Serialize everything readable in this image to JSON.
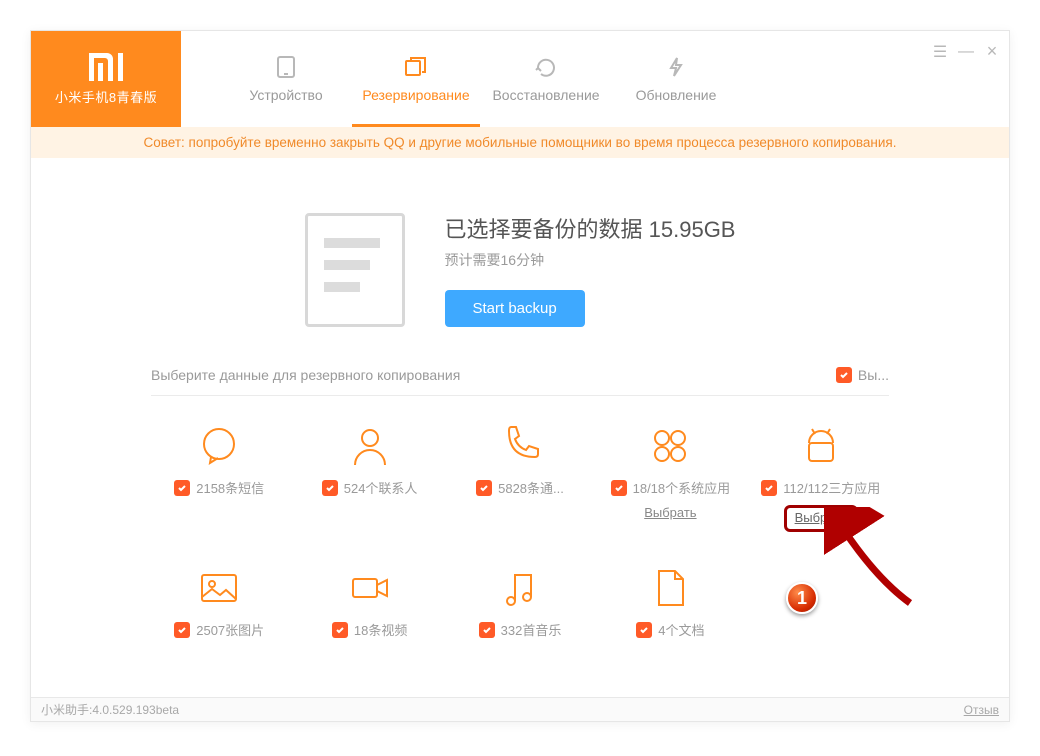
{
  "header": {
    "device_name": "小米手机8青春版",
    "nav": {
      "device": "Устройство",
      "backup": "Резервирование",
      "restore": "Восстановление",
      "update": "Обновление"
    }
  },
  "tip_banner": "Совет: попробуйте временно закрыть QQ и другие мобильные помощники во время процесса резервного копирования.",
  "summary": {
    "title_prefix": "已选择要备份的数据",
    "size": "15.95GB",
    "eta": "预计需要16分钟",
    "button": "Start backup"
  },
  "section": {
    "title": "Выберите данные для резервного копирования",
    "select_all": "Вы...",
    "choose_label": "Выбрать"
  },
  "categories": {
    "sms": {
      "label": "2158条短信"
    },
    "contacts": {
      "label": "524个联系人"
    },
    "calllog": {
      "label": "5828条通..."
    },
    "sysapps": {
      "label": "18/18个系统应用"
    },
    "thirdparty": {
      "label": "112/112三方应用"
    },
    "photos": {
      "label": "2507张图片"
    },
    "videos": {
      "label": "18条视频"
    },
    "music": {
      "label": "332首音乐"
    },
    "docs": {
      "label": "4个文档"
    }
  },
  "status": {
    "version": "小米助手:4.0.529.193beta",
    "feedback": "Отзыв"
  },
  "callout_number": "1",
  "colors": {
    "accent": "#ff8a1e",
    "primary_btn": "#3ea9ff",
    "check": "#ff5a27"
  }
}
